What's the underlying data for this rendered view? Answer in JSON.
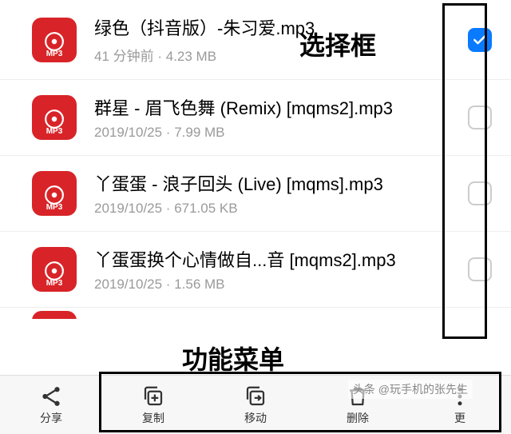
{
  "annotations": {
    "selection_box": "选择框",
    "function_menu": "功能菜单"
  },
  "icon_format_label": "MP3",
  "files": [
    {
      "title": "绿色（抖音版）-朱习爱.mp3",
      "meta": "41 分钟前 · 4.23 MB",
      "checked": true
    },
    {
      "title": "群星 - 眉飞色舞 (Remix) [mqms2].mp3",
      "meta": "2019/10/25 · 7.99 MB",
      "checked": false
    },
    {
      "title": "丫蛋蛋 - 浪子回头 (Live) [mqms].mp3",
      "meta": "2019/10/25 · 671.05 KB",
      "checked": false
    },
    {
      "title": "丫蛋蛋换个心情做自...音 [mqms2].mp3",
      "meta": "2019/10/25 · 1.56 MB",
      "checked": false
    }
  ],
  "toolbar": {
    "share": "分享",
    "copy": "复制",
    "move": "移动",
    "delete": "删除",
    "more": "更"
  },
  "watermark": "头条 @玩手机的张先生"
}
